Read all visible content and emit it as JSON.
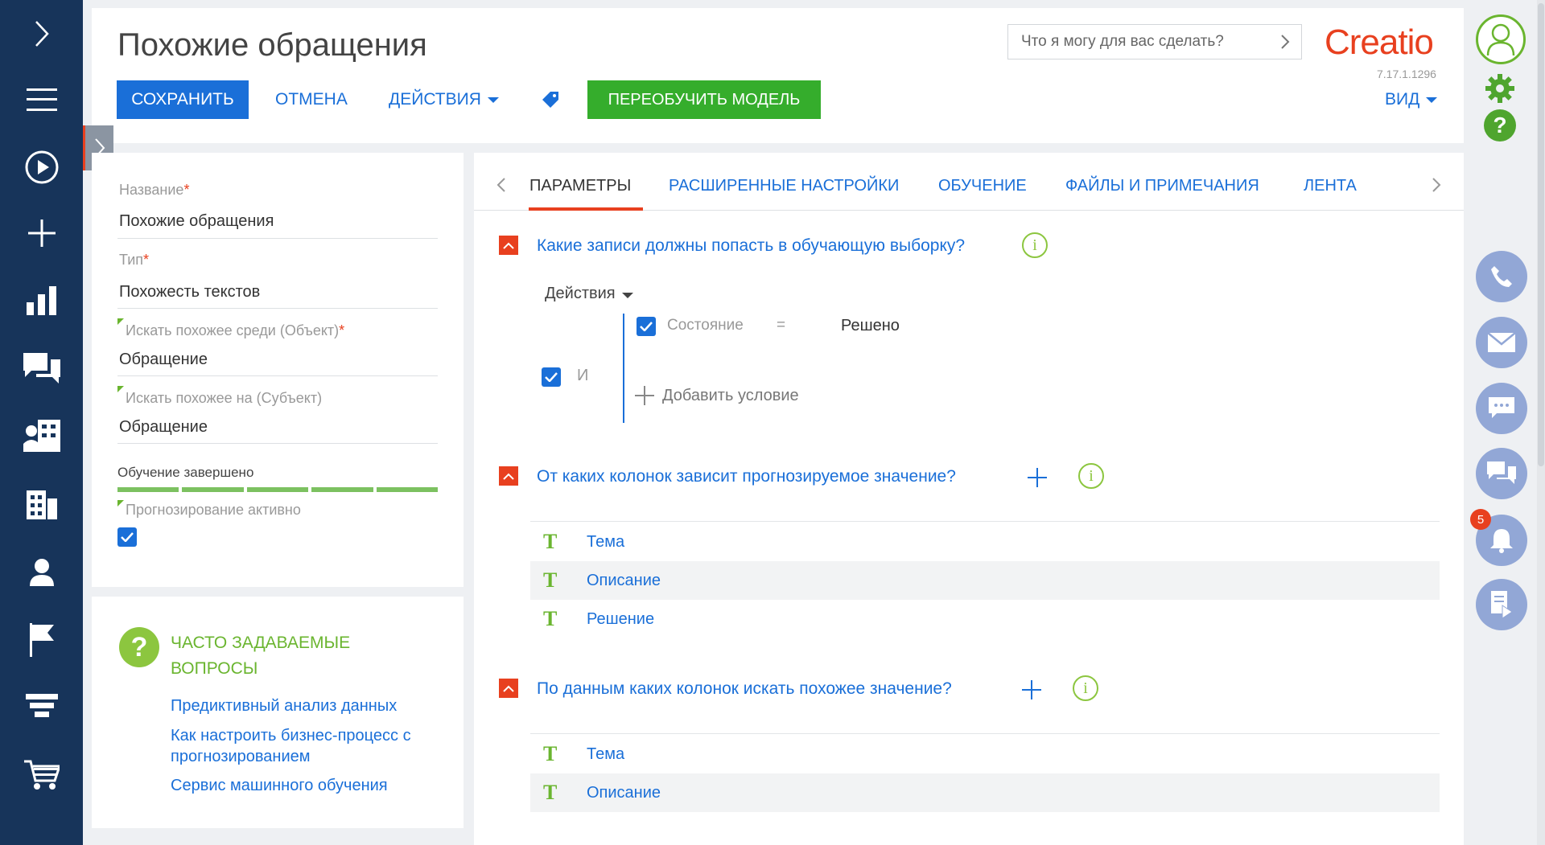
{
  "header": {
    "title": "Похожие обращения",
    "save_label": "СОХРАНИТЬ",
    "cancel_label": "ОТМЕНА",
    "actions_label": "ДЕЙСТВИЯ",
    "retrain_label": "ПЕРЕОБУЧИТЬ МОДЕЛЬ",
    "view_label": "ВИД",
    "search_placeholder": "Что я могу для вас сделать?",
    "logo_text": "Creatio",
    "version": "7.17.1.1296"
  },
  "left_nav": {
    "icons": [
      "expand-icon",
      "menu-icon",
      "play-icon",
      "plus-icon",
      "chart-icon",
      "chat-icon",
      "contacts-icon",
      "accounts-icon",
      "person-icon",
      "flag-icon",
      "funnel-icon",
      "cart-icon"
    ]
  },
  "form": {
    "name_label": "Название",
    "name_value": "Похожие обращения",
    "type_label": "Тип",
    "type_value": "Похожесть текстов",
    "search_among_label": "Искать похожее среди (Объект)",
    "search_among_value": "Обращение",
    "search_on_label": "Искать похожее на (Субъект)",
    "search_on_value": "Обращение",
    "training_status": "Обучение завершено",
    "training_progress": 1.0,
    "forecast_active_label": "Прогнозирование активно",
    "forecast_active": true
  },
  "faq": {
    "title": "ЧАСТО ЗАДАВАЕМЫЕ ВОПРОСЫ",
    "links": [
      "Предиктивный анализ данных",
      "Как настроить бизнес-процесс с прогнозированием",
      "Сервис машинного обучения"
    ]
  },
  "tabs": [
    "ПАРАМЕТРЫ",
    "РАСШИРЕННЫЕ НАСТРОЙКИ",
    "ОБУЧЕНИЕ",
    "ФАЙЛЫ И ПРИМЕЧАНИЯ",
    "ЛЕНТА"
  ],
  "sections": {
    "training_set": {
      "title": "Какие записи должны попасть в обучающую выборку?",
      "actions_label": "Действия",
      "group_operator": "И",
      "condition": {
        "column": "Состояние",
        "operator": "=",
        "value": "Решено"
      },
      "add_condition_label": "Добавить условие"
    },
    "dependent_columns": {
      "title": "От каких колонок зависит прогнозируемое значение?",
      "columns": [
        "Тема",
        "Описание",
        "Решение"
      ]
    },
    "similar_columns": {
      "title": "По данным каких колонок искать похожее значение?",
      "columns": [
        "Тема",
        "Описание"
      ]
    }
  },
  "right_panel": {
    "notifications_count": "5"
  },
  "colors": {
    "nav_bg": "#17345a",
    "primary": "#1a6fd8",
    "success": "#35ad2c",
    "accent": "#e8401f"
  }
}
